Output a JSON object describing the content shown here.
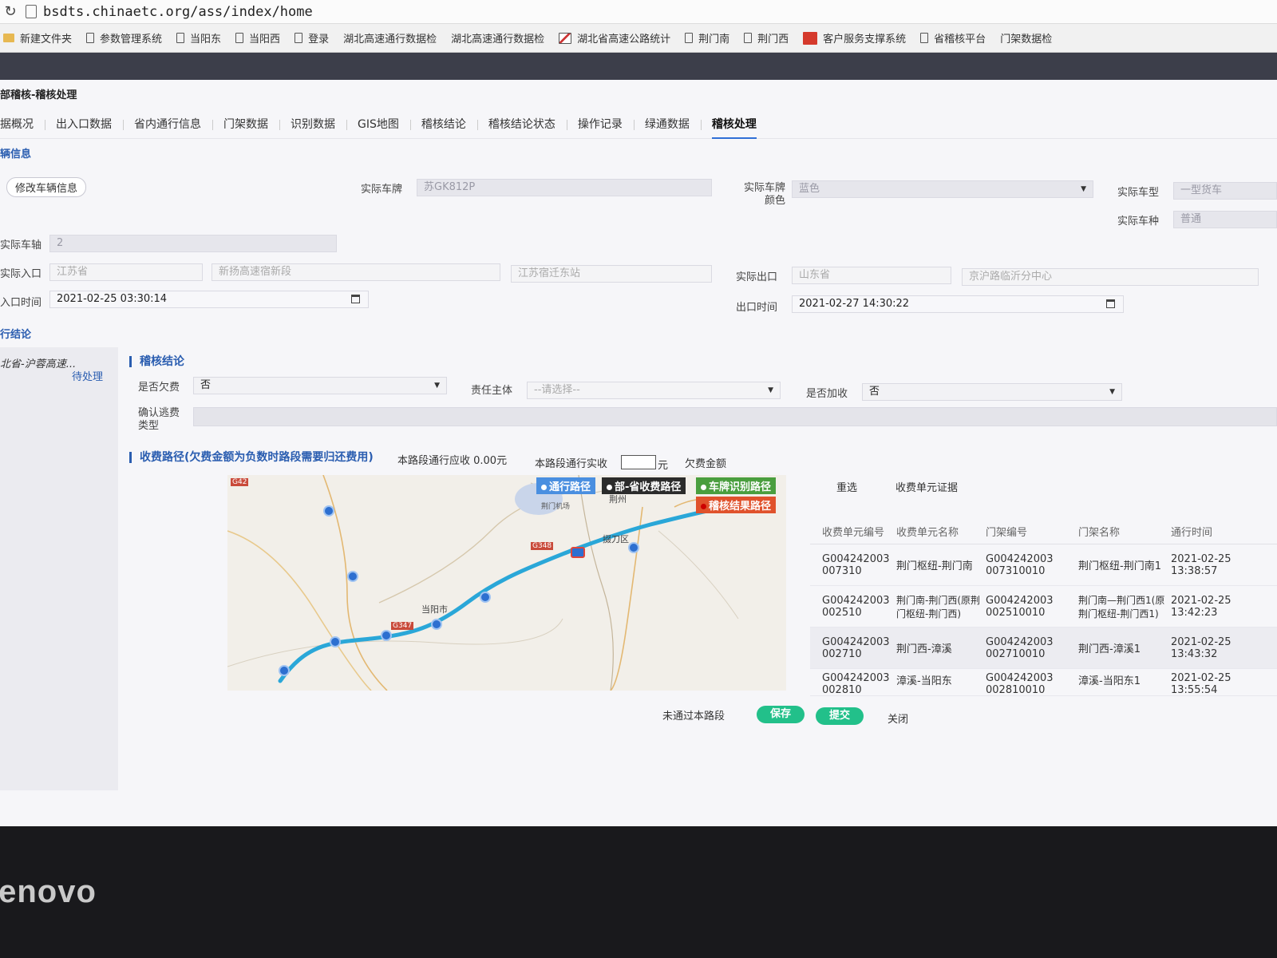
{
  "browser": {
    "url": "bsdts.chinaetc.org/ass/index/home",
    "bookmarks": [
      "新建文件夹",
      "参数管理系统",
      "当阳东",
      "当阳西",
      "登录",
      "湖北高速通行数据检",
      "湖北高速通行数据检",
      "湖北省高速公路统计",
      "荆门南",
      "荆门西",
      "客户服务支撑系统",
      "省稽核平台",
      "门架数据检"
    ]
  },
  "page": {
    "breadcrumb": "部稽核-稽核处理",
    "tabs": [
      "据概况",
      "出入口数据",
      "省内通行信息",
      "门架数据",
      "识别数据",
      "GIS地图",
      "稽核结论",
      "稽核结论状态",
      "操作记录",
      "绿通数据",
      "稽核处理"
    ],
    "active_tab": "稽核处理"
  },
  "vehicle": {
    "section_title": "辆信息",
    "modify_button": "修改车辆信息",
    "plate_label": "实际车牌",
    "plate_value": "苏GK812P",
    "plate_color_label": "实际车牌颜色",
    "plate_color_value": "蓝色",
    "type_label": "实际车型",
    "type_value": "一型货车",
    "kind_label": "实际车种",
    "kind_value": "普通",
    "axle_label": "实际车轴",
    "axle_value": "2",
    "entry_label": "实际入口",
    "entry_province": "江苏省",
    "entry_section": "新扬高速宿新段",
    "entry_station": "江苏宿迁东站",
    "exit_label": "实际出口",
    "exit_province": "山东省",
    "exit_station": "京沪路临沂分中心",
    "entry_time_label": "入口时间",
    "entry_time": "2021-02-25 03:30:14",
    "exit_time_label": "出口时间",
    "exit_time": "2021-02-27 14:30:22"
  },
  "conclusion": {
    "section_title": "行结论",
    "left_item": "北省-沪蓉高速...",
    "left_status": "待处理",
    "subtitle": "稽核结论",
    "owed_label": "是否欠费",
    "owed_value": "否",
    "party_label": "责任主体",
    "party_placeholder": "--请选择--",
    "surcharge_label": "是否加收",
    "surcharge_value": "否",
    "evasion_label": "确认逃费类型"
  },
  "route": {
    "subtitle": "收费路径(欠费金额为负数时路段需要归还费用)",
    "due_text": "本路段通行应收 0.00元",
    "paid_label": "本路段通行实收",
    "paid_unit": "元",
    "owed_label": "欠费金额",
    "legend": [
      "通行路径",
      "部-省收费路径",
      "车牌识别路径",
      "稽核结果路径"
    ],
    "reselect_button": "重选",
    "evidence_button": "收费单元证据",
    "map_labels": [
      "当阳市",
      "掇刀区",
      "荆州",
      "G348",
      "G347",
      "G42",
      "荆门机场"
    ]
  },
  "table": {
    "headers": [
      "收费单元编号",
      "收费单元名称",
      "门架编号",
      "门架名称",
      "通行时间"
    ],
    "rows": [
      [
        "G004242003 007310",
        "荆门枢纽-荆门南",
        "G004242003 007310010",
        "荆门枢纽-荆门南1",
        "2021-02-25 13:38:57"
      ],
      [
        "G004242003 002510",
        "荆门南-荆门西(原荆门枢纽-荆门西)",
        "G004242003 002510010",
        "荆门南—荆门西1(原荆门枢纽-荆门西1)",
        "2021-02-25 13:42:23"
      ],
      [
        "G004242003 002710",
        "荆门西-漳溪",
        "G004242003 002710010",
        "荆门西-漳溪1",
        "2021-02-25 13:43:32"
      ],
      [
        "G004242003 002810",
        "漳溪-当阳东",
        "G004242003 002810010",
        "漳溪-当阳东1",
        "2021-02-25 13:55:54"
      ]
    ]
  },
  "actions": {
    "not_pass": "未通过本路段",
    "save": "保存",
    "submit": "提交",
    "close": "关闭"
  },
  "monitor": {
    "brand": "lenovo"
  },
  "colors": {
    "accent": "#2a5db0",
    "route": "#2aa7d8",
    "green_button": "#22c08a"
  }
}
